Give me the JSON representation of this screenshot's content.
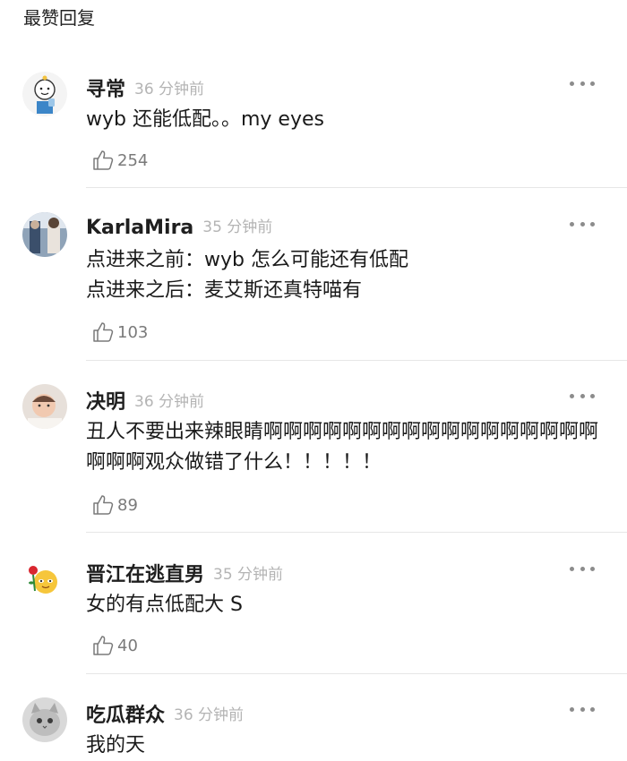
{
  "section_title": "最赞回复",
  "comments": [
    {
      "name": "寻常",
      "time": "36 分钟前",
      "text": "wyb 还能低配。。my eyes",
      "likes": "254",
      "avatar": "cartoon-avatar"
    },
    {
      "name": "KarlaMira",
      "time": "35 分钟前",
      "text": "点进来之前：wyb 怎么可能还有低配\n点进来之后：麦艾斯还真特喵有",
      "likes": "103",
      "avatar": "photo-avatar"
    },
    {
      "name": "决明",
      "time": "36 分钟前",
      "text": "丑人不要出来辣眼睛啊啊啊啊啊啊啊啊啊啊啊啊啊啊啊啊啊啊啊啊观众做错了什么！！！！！",
      "likes": "89",
      "avatar": "baby-photo-avatar"
    },
    {
      "name": "晋江在逃直男",
      "time": "35 分钟前",
      "text": "女的有点低配大 S",
      "likes": "40",
      "avatar": "rose-emoji-avatar"
    },
    {
      "name": "吃瓜群众",
      "time": "36 分钟前",
      "text": "我的天",
      "avatar": "cat-avatar"
    }
  ]
}
